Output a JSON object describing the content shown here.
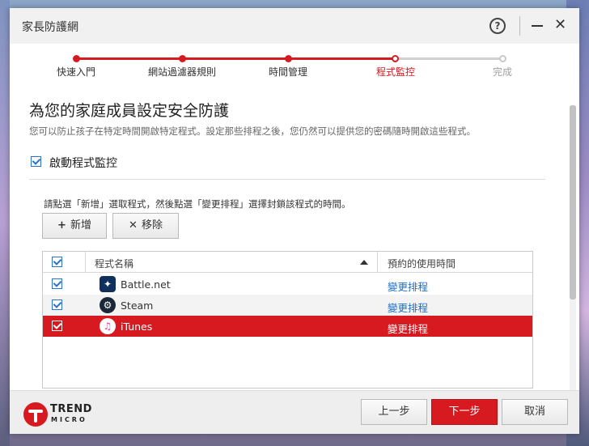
{
  "window": {
    "title": "家長防護網"
  },
  "steps": [
    {
      "label": "快速入門",
      "state": "done"
    },
    {
      "label": "網站過濾器規則",
      "state": "done"
    },
    {
      "label": "時間管理",
      "state": "done"
    },
    {
      "label": "程式監控",
      "state": "current"
    },
    {
      "label": "完成",
      "state": "todo"
    }
  ],
  "main": {
    "heading": "為您的家庭成員設定安全防護",
    "subtext": "您可以防止孩子在特定時間開啟特定程式。設定那些排程之後，您仍然可以提供您的密碼隨時開啟這些程式。",
    "enable_label": "啟動程式監控",
    "enable_checked": true,
    "instruction": "請點選「新增」選取程式，然後點選「變更排程」選擇封鎖該程式的時間。",
    "add_label": "新增",
    "remove_label": "移除"
  },
  "table": {
    "col_name": "程式名稱",
    "col_time": "預約的使用時間",
    "rows": [
      {
        "name": "Battle.net",
        "icon": "battlenet-icon",
        "schedule": "變更排程",
        "checked": true
      },
      {
        "name": "Steam",
        "icon": "steam-icon",
        "schedule": "變更排程",
        "checked": true
      },
      {
        "name": "iTunes",
        "icon": "itunes-icon",
        "schedule": "變更排程",
        "checked": true
      }
    ]
  },
  "footer": {
    "brand_line1": "TREND",
    "brand_line2": "MICRO",
    "back_label": "上一步",
    "next_label": "下一步",
    "cancel_label": "取消"
  },
  "colors": {
    "accent": "#d71920",
    "link": "#1e6fc4",
    "checkbox": "#2a72c9"
  }
}
